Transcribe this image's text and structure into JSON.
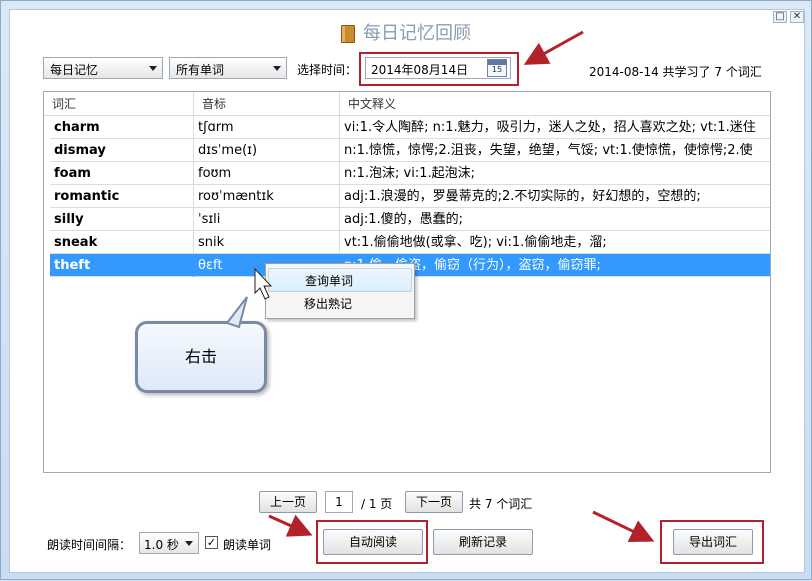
{
  "title": "每日记忆回顾",
  "filters": {
    "mode": "每日记忆",
    "scope": "所有单词",
    "date_label": "选择时间：",
    "date_value": "2014年08月14日",
    "calendar_day": "15",
    "summary": "2014-08-14 共学习了 7 个词汇"
  },
  "table": {
    "headers": [
      "词汇",
      "音标",
      "中文释义"
    ],
    "rows": [
      {
        "word": "charm",
        "phonetic": "tʃɑrm",
        "meaning": "vi:1.令人陶醉; n:1.魅力，吸引力，迷人之处，招人喜欢之处; vt:1.迷住"
      },
      {
        "word": "dismay",
        "phonetic": "dɪsˈme(ɪ)",
        "meaning": "n:1.惊慌，惊愕;2.沮丧，失望，绝望，气馁; vt:1.使惊慌，使惊愕;2.使"
      },
      {
        "word": "foam",
        "phonetic": "foʊm",
        "meaning": "n:1.泡沫; vi:1.起泡沫;"
      },
      {
        "word": "romantic",
        "phonetic": "roʊˈmæntɪk",
        "meaning": "adj:1.浪漫的，罗曼蒂克的;2.不切实际的，好幻想的，空想的;"
      },
      {
        "word": "silly",
        "phonetic": "ˈsɪli",
        "meaning": "adj:1.傻的，愚蠢的;"
      },
      {
        "word": "sneak",
        "phonetic": "snik",
        "meaning": "vt:1.偷偷地做(或拿、吃); vi:1.偷偷地走，溜;"
      },
      {
        "word": "theft",
        "phonetic": "θɛft",
        "meaning": "n:1.偷，偷盗，偷窃（行为），盗窃，偷窃罪;"
      }
    ]
  },
  "context_menu": {
    "items": [
      "查询单词",
      "移出熟记"
    ]
  },
  "callout": "右击",
  "pagination": {
    "prev": "上一页",
    "current": "1",
    "total": "/ 1 页",
    "next": "下一页",
    "count": "共 7 个词汇"
  },
  "bottom": {
    "interval_label": "朗读时间间隔：",
    "interval_value": "1.0 秒",
    "read_word_label": "朗读单词",
    "read_word_checked": "✓",
    "auto_read": "自动阅读",
    "refresh": "刷新记录",
    "export": "导出词汇"
  },
  "window_controls": {
    "maximize": "□",
    "close": "✕"
  },
  "colors": {
    "selection": "#3399ff",
    "annotation_red": "#b3222a"
  }
}
